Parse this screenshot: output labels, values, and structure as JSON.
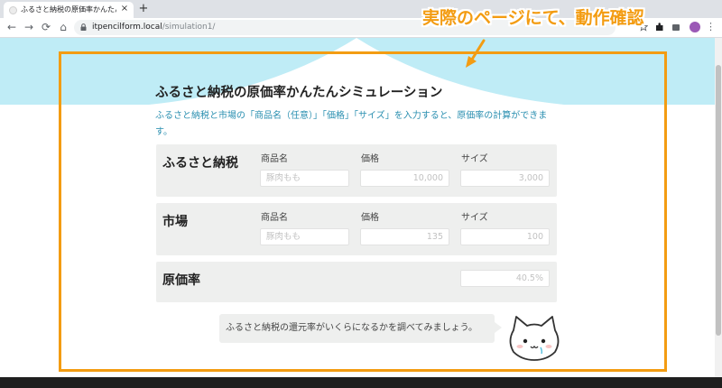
{
  "browser": {
    "tab_title": "ふるさと納税の原価率かんたんシミュ",
    "close_glyph": "×",
    "new_tab_glyph": "+",
    "back_glyph": "←",
    "forward_glyph": "→",
    "reload_glyph": "⟳",
    "home_glyph": "⌂",
    "url_host": "itpencilform.local",
    "url_path": "/simulation1/",
    "menu_glyph": "⋮"
  },
  "page": {
    "title": "ふるさと納税の原価率かんたんシミュレーション",
    "description": "ふるさと納税と市場の「商品名（任意）」「価格」「サイズ」を入力すると、原価率の計算ができます。",
    "furusato": {
      "label": "ふるさと納税",
      "name_label": "商品名",
      "price_label": "価格",
      "size_label": "サイズ",
      "name_placeholder": "豚肉もも",
      "price_placeholder": "10,000",
      "size_placeholder": "3,000"
    },
    "market": {
      "label": "市場",
      "name_label": "商品名",
      "price_label": "価格",
      "size_label": "サイズ",
      "name_placeholder": "豚肉もも",
      "price_placeholder": "135",
      "size_placeholder": "100"
    },
    "cost_rate": {
      "label": "原価率",
      "value_placeholder": "40.5%"
    },
    "bubble_text": "ふるさと納税の還元率がいくらになるかを調べてみましょう。"
  },
  "annotation": {
    "label": "実際のページにて、動作確認",
    "color": "#f39c12"
  },
  "colors": {
    "hero_bg": "#bfecf6",
    "description_text": "#2a8fb0",
    "panel_bg": "#eeefee"
  }
}
